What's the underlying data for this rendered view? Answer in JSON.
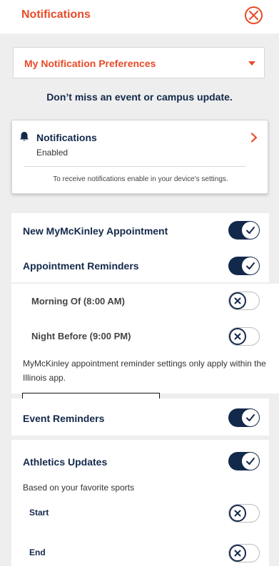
{
  "header": {
    "title": "Notifications"
  },
  "preferences": {
    "label": "My Notification Preferences"
  },
  "tagline": "Don’t miss an event or campus update.",
  "notifications_card": {
    "title": "Notifications",
    "status": "Enabled",
    "hint": "To receive notifications enable in your device's settings."
  },
  "rows": {
    "new_appointment": {
      "label": "New MyMcKinley Appointment",
      "enabled": true
    },
    "appointment_reminders": {
      "label": "Appointment Reminders",
      "enabled": true
    },
    "morning_of": {
      "label": "Morning Of (8:00 AM)",
      "enabled": false
    },
    "night_before": {
      "label": "Night Before (9:00 PM)",
      "enabled": false
    },
    "reminder_note": "MyMcKinley appointment reminder settings only apply within the Illinois app.",
    "event_reminders": {
      "label": "Event Reminders",
      "enabled": true
    },
    "athletics_updates": {
      "label": "Athletics Updates",
      "enabled": true
    },
    "athletics_note": "Based on your favorite sports",
    "start": {
      "label": "Start",
      "enabled": false
    },
    "end": {
      "label": "End",
      "enabled": false
    }
  },
  "colors": {
    "accent": "#e84a27",
    "navy": "#13294b",
    "background": "#eeeeee"
  }
}
